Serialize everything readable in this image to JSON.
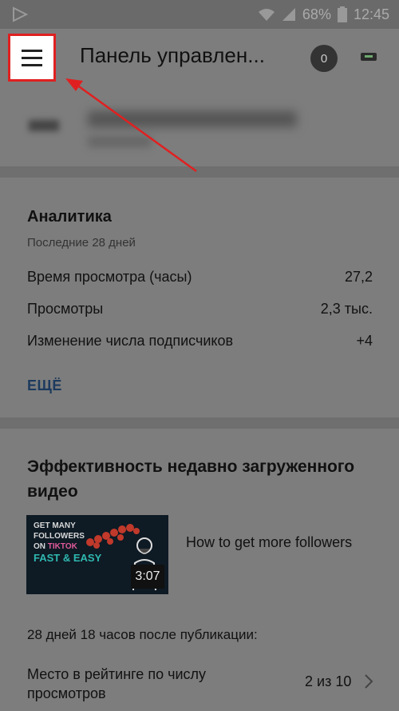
{
  "status_bar": {
    "battery": "68%",
    "time": "12:45"
  },
  "app_bar": {
    "title": "Панель управлен...",
    "notification_count": "0",
    "menu_icon": "hamburger-menu-icon"
  },
  "analytics": {
    "title": "Аналитика",
    "period": "Последние 28 дней",
    "stats": [
      {
        "label": "Время просмотра (часы)",
        "value": "27,2"
      },
      {
        "label": "Просмотры",
        "value": "2,3 тыс."
      },
      {
        "label": "Изменение числа подписчиков",
        "value": "+4"
      }
    ],
    "more_label": "ЕЩЁ"
  },
  "recent_video": {
    "section_title": "Эффективность недавно загруженного видео",
    "thumbnail_lines": [
      "GET MANY",
      "FOLLOWERS",
      "ON TIKTOK",
      "FAST & EASY"
    ],
    "duration": "3:07",
    "video_title": "How to get more followers",
    "since_publication": "28 дней 18 часов после публикации:",
    "rank_label": "Место в рейтинге по числу просмотров",
    "rank_value": "2 из 10"
  },
  "colors": {
    "annotation_red": "#e02020",
    "link_blue": "#1c3a5e",
    "overlay_gray": "#7d7d7d"
  }
}
